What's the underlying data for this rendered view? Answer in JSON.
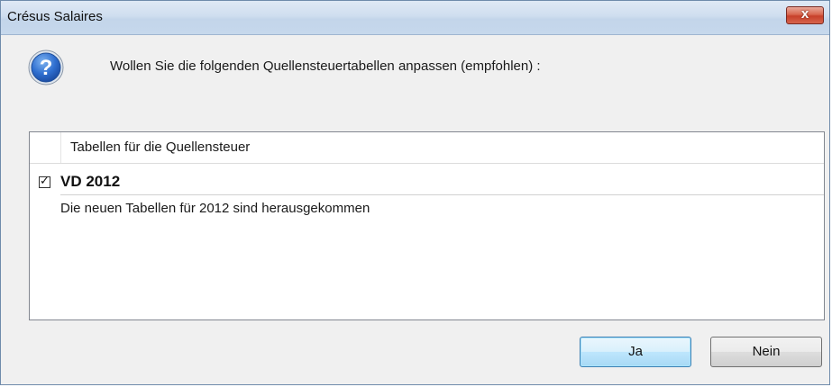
{
  "window": {
    "title": "Crésus Salaires",
    "close_glyph": "x"
  },
  "dialog": {
    "icon": "question-icon",
    "prompt": "Wollen Sie die folgenden Quellensteuertabellen anpassen (empfohlen) :"
  },
  "list": {
    "header": "Tabellen für die Quellensteuer",
    "items": [
      {
        "checked": true,
        "check_glyph": "✓",
        "title": "VD 2012",
        "description": "Die neuen Tabellen für 2012 sind herausgekommen"
      }
    ]
  },
  "buttons": {
    "yes": "Ja",
    "no": "Nein"
  },
  "colors": {
    "titlebar": "#c6d8ec",
    "close_button": "#c7402a",
    "default_button": "#bee6fd",
    "dialog_background": "#f0f0f0"
  }
}
